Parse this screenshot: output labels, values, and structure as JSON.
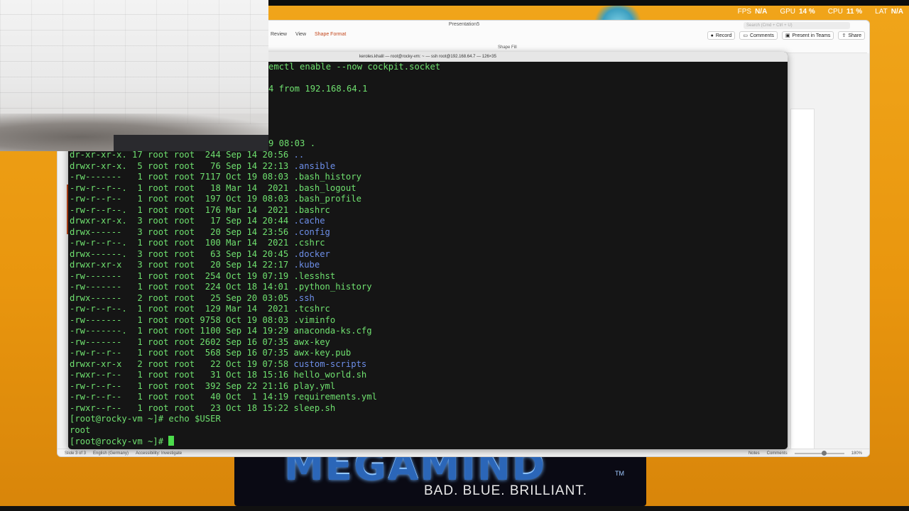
{
  "overlay": {
    "stats": [
      {
        "label": "FPS",
        "value": "N/A"
      },
      {
        "label": "GPU",
        "value": "14 %"
      },
      {
        "label": "CPU",
        "value": "11 %"
      },
      {
        "label": "LAT",
        "value": "N/A"
      }
    ]
  },
  "wallpaper": {
    "title": "MEGAMIND",
    "tm": "TM",
    "tagline": "BAD. BLUE. BRILLIANT."
  },
  "ppt": {
    "window_title": "Presentation5",
    "search_placeholder": "Search (Cmd + Ctrl + U)",
    "tabs": [
      "Review",
      "View",
      "Shape Format"
    ],
    "actions": [
      {
        "icon": "record-icon",
        "glyph": "●",
        "label": "Record"
      },
      {
        "icon": "comments-icon",
        "glyph": "▭",
        "label": "Comments"
      },
      {
        "icon": "teams-icon",
        "glyph": "▣",
        "label": "Present in Teams"
      },
      {
        "icon": "share-icon",
        "glyph": "⇪",
        "label": "Share"
      }
    ],
    "shape_fill": "Shape Fill",
    "slide_number": "3",
    "status_left": [
      "Slide 3 of 3",
      "English (Germany)",
      "Accessibility: Investigate"
    ],
    "status_right": [
      "Notes",
      "Comments"
    ],
    "zoom": "180%"
  },
  "terminal": {
    "title": "keroles.khalil — root@rocky-vm: ~ — ssh root@192.168.64.7 — 126×35",
    "top_lines": [
      "emctl enable --now cockpit.socket",
      "",
      "4 from 192.168.64.1"
    ],
    "listing": [
      {
        "meta": "dr-xr-xr-x. 17 root root  244 Sep 14 20:56 ",
        "name": "..",
        "dir": true
      },
      {
        "meta": "drwxr-xr-x.  5 root root   76 Sep 14 22:13 ",
        "name": ".ansible",
        "dir": true
      },
      {
        "meta": "-rw-------   1 root root 7117 Oct 19 08:03 ",
        "name": ".bash_history",
        "dir": false
      },
      {
        "meta": "-rw-r--r--.  1 root root   18 Mar 14  2021 ",
        "name": ".bash_logout",
        "dir": false
      },
      {
        "meta": "-rw-r--r--   1 root root  197 Oct 19 08:03 ",
        "name": ".bash_profile",
        "dir": false
      },
      {
        "meta": "-rw-r--r--.  1 root root  176 Mar 14  2021 ",
        "name": ".bashrc",
        "dir": false
      },
      {
        "meta": "drwxr-xr-x.  3 root root   17 Sep 14 20:44 ",
        "name": ".cache",
        "dir": true
      },
      {
        "meta": "drwx------   3 root root   20 Sep 14 23:56 ",
        "name": ".config",
        "dir": true
      },
      {
        "meta": "-rw-r--r--.  1 root root  100 Mar 14  2021 ",
        "name": ".cshrc",
        "dir": false
      },
      {
        "meta": "drwx------.  3 root root   63 Sep 14 20:45 ",
        "name": ".docker",
        "dir": true
      },
      {
        "meta": "drwxr-xr-x   3 root root   20 Sep 14 22:17 ",
        "name": ".kube",
        "dir": true
      },
      {
        "meta": "-rw-------   1 root root  254 Oct 19 07:19 ",
        "name": ".lesshst",
        "dir": false
      },
      {
        "meta": "-rw-------   1 root root  224 Oct 18 14:01 ",
        "name": ".python_history",
        "dir": false
      },
      {
        "meta": "drwx------   2 root root   25 Sep 20 03:05 ",
        "name": ".ssh",
        "dir": true
      },
      {
        "meta": "-rw-r--r--.  1 root root  129 Mar 14  2021 ",
        "name": ".tcshrc",
        "dir": false
      },
      {
        "meta": "-rw-------   1 root root 9758 Oct 19 08:03 ",
        "name": ".viminfo",
        "dir": false
      },
      {
        "meta": "-rw-------.  1 root root 1100 Sep 14 19:29 ",
        "name": "anaconda-ks.cfg",
        "dir": false
      },
      {
        "meta": "-rw-------   1 root root 2602 Sep 16 07:35 ",
        "name": "awx-key",
        "dir": false
      },
      {
        "meta": "-rw-r--r--   1 root root  568 Sep 16 07:35 ",
        "name": "awx-key.pub",
        "dir": false
      },
      {
        "meta": "drwxr-xr-x   2 root root   22 Oct 19 07:58 ",
        "name": "custom-scripts",
        "dir": true
      },
      {
        "meta": "-rwxr--r--   1 root root   31 Oct 18 15:16 ",
        "name": "hello_world.sh",
        "dir": false
      },
      {
        "meta": "-rw-r--r--   1 root root  392 Sep 22 21:16 ",
        "name": "play.yml",
        "dir": false
      },
      {
        "meta": "-rw-r--r--   1 root root   40 Oct  1 14:19 ",
        "name": "requirements.yml",
        "dir": false
      },
      {
        "meta": "-rwxr--r--   1 root root   23 Oct 18 15:22 ",
        "name": "sleep.sh",
        "dir": false
      }
    ],
    "partial_line": "9 08:03 .",
    "command_line": "[root@rocky-vm ~]# echo $USER",
    "output_line": "root",
    "prompt": "[root@rocky-vm ~]# "
  },
  "colors": {
    "terminal_text": "#6fe06f",
    "terminal_dir": "#6d8ee8",
    "terminal_bg": "#151515",
    "desktop": "#e9960e"
  }
}
